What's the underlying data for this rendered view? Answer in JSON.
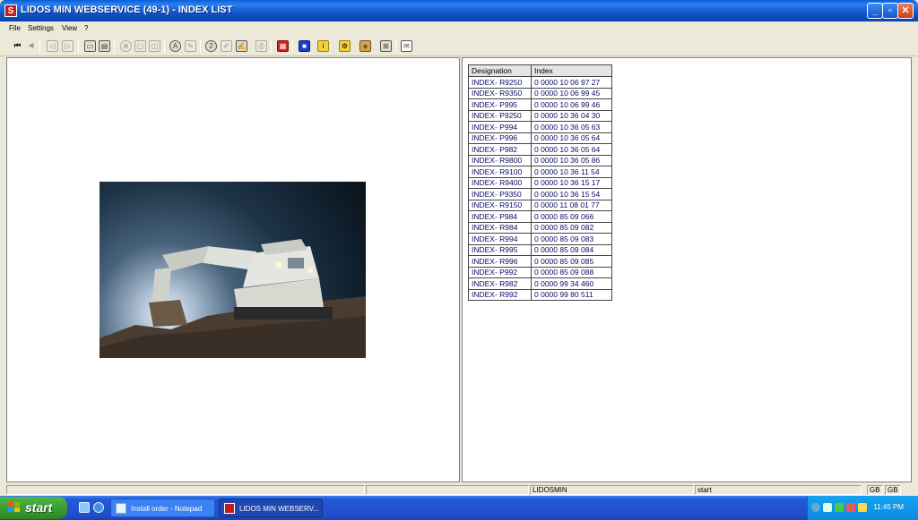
{
  "window": {
    "title": "LIDOS MIN WEBSERVICE (49-1) - INDEX LIST",
    "app_icon": "S",
    "controls": {
      "minimize": "_",
      "maximize": "▫",
      "close": "✕"
    }
  },
  "menu": {
    "file": "File",
    "settings": "Settings",
    "view": "View",
    "help": "?"
  },
  "toolbar": {
    "icons": [
      "first-page-icon",
      "previous-icon",
      "back-icon",
      "forward-icon",
      "cart-icon",
      "notes-icon",
      "zoom-icon",
      "page-icon",
      "page-copy-icon",
      "search-a-icon",
      "tools-icon",
      "help-icon",
      "edit-icon",
      "notepad-icon",
      "print-icon",
      "grid-red-icon",
      "blue-square-icon",
      "info-yellow-icon",
      "settings-yellow-icon",
      "badge-icon",
      "hierarchy-icon",
      "mail-icon"
    ]
  },
  "index_table": {
    "headers": {
      "designation": "Designation",
      "index": "Index"
    },
    "rows": [
      {
        "designation": "INDEX- R9250",
        "index": "0 0000 10 06 97 27"
      },
      {
        "designation": "INDEX- R9350",
        "index": "0 0000 10 06 99 45"
      },
      {
        "designation": "INDEX- P995",
        "index": "0 0000 10 06 99 46"
      },
      {
        "designation": "INDEX- P9250",
        "index": "0 0000 10 36 04 30"
      },
      {
        "designation": "INDEX- P994",
        "index": "0 0000 10 36 05 63"
      },
      {
        "designation": "INDEX- P996",
        "index": "0 0000 10 36 05 64"
      },
      {
        "designation": "INDEX- P982",
        "index": "0 0000 10 36 05 64"
      },
      {
        "designation": "INDEX- R9800",
        "index": "0 0000 10 36 05 86"
      },
      {
        "designation": "INDEX- R9100",
        "index": "0 0000 10 36 11 54"
      },
      {
        "designation": "INDEX- R9400",
        "index": "0 0000 10 36 15 17"
      },
      {
        "designation": "INDEX- P9350",
        "index": "0 0000 10 36 15 54"
      },
      {
        "designation": "INDEX- R9150",
        "index": "0 0000 11 08 01 77"
      },
      {
        "designation": "INDEX- P984",
        "index": "0 0000 85 09 066"
      },
      {
        "designation": "INDEX- R984",
        "index": "0 0000 85 09 082"
      },
      {
        "designation": "INDEX- R994",
        "index": "0 0000 85 09 083"
      },
      {
        "designation": "INDEX- R995",
        "index": "0 0000 85 09 084"
      },
      {
        "designation": "INDEX- R996",
        "index": "0 0000 85 09 085"
      },
      {
        "designation": "INDEX- P992",
        "index": "0 0000 85 09 088"
      },
      {
        "designation": "INDEX- R982",
        "index": "0 0000 99 34 460"
      },
      {
        "designation": "INDEX- R992",
        "index": "0 0000 99 80 511"
      }
    ]
  },
  "statusbar": {
    "user": "LIDOSMIN",
    "state": "start",
    "lang1": "GB",
    "lang2": "GB"
  },
  "taskbar": {
    "start_label": "start",
    "tasks": [
      {
        "label": "Install order - Notepad"
      },
      {
        "label": "LIDOS MIN WEBSERV..."
      }
    ],
    "clock": "11:45 PM"
  },
  "colors": {
    "titlebar": "#0a5fd9",
    "taskbar": "#2459d8",
    "start": "#379b2f"
  }
}
